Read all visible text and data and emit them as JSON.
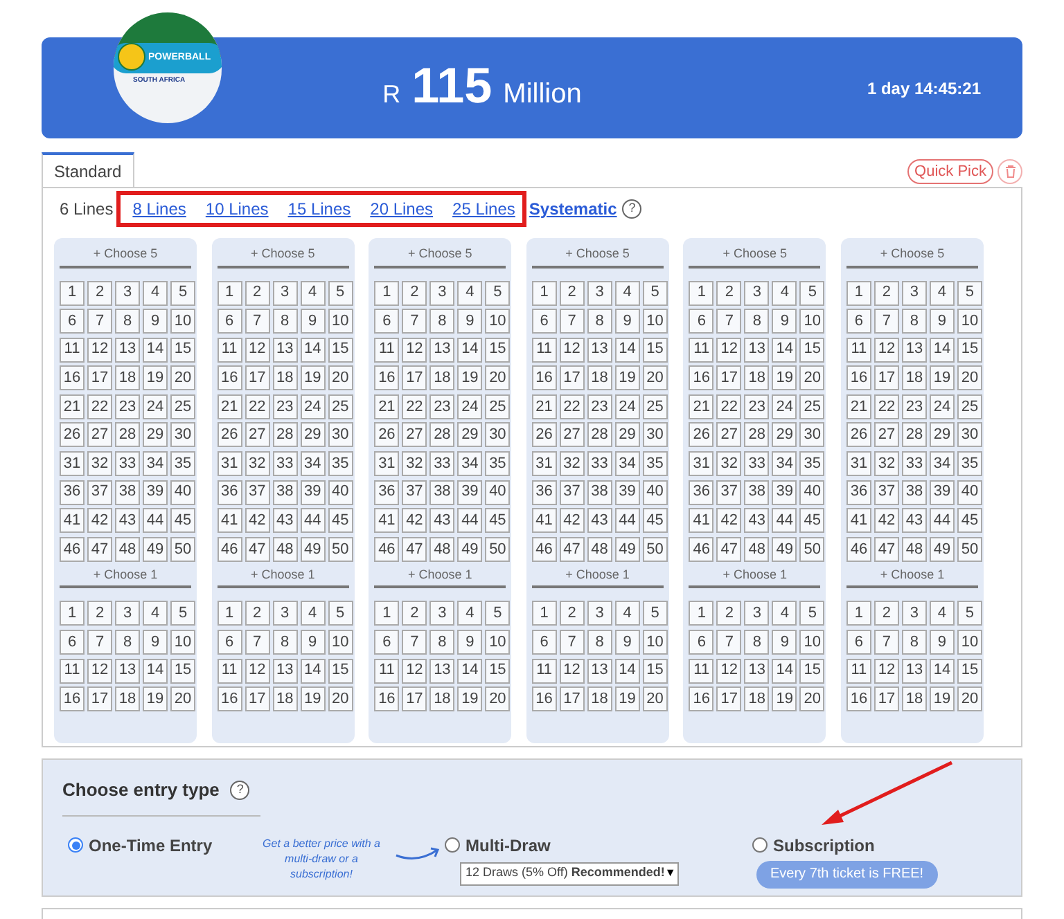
{
  "banner": {
    "logo_title": "POWERBALL",
    "logo_subtitle": "SOUTH AFRICA",
    "currency": "R",
    "amount": "115",
    "unit": "Million",
    "countdown": "1 day 14:45:21"
  },
  "tabs": [
    {
      "label": "Standard",
      "selected": true
    }
  ],
  "quick_pick": "Quick Pick",
  "line_options": [
    {
      "label": "6 Lines",
      "selected": true
    },
    {
      "label": "8 Lines",
      "selected": false
    },
    {
      "label": "10 Lines",
      "selected": false
    },
    {
      "label": "15 Lines",
      "selected": false
    },
    {
      "label": "20 Lines",
      "selected": false
    },
    {
      "label": "25 Lines",
      "selected": false
    }
  ],
  "systematic": {
    "label": "Systematic",
    "help": "?"
  },
  "tickets": [
    {
      "sections": [
        {
          "label": "+ Choose 5",
          "numbers": [
            "1",
            "2",
            "3",
            "4",
            "5",
            "6",
            "7",
            "8",
            "9",
            "10",
            "11",
            "12",
            "13",
            "14",
            "15",
            "16",
            "17",
            "18",
            "19",
            "20",
            "21",
            "22",
            "23",
            "24",
            "25",
            "26",
            "27",
            "28",
            "29",
            "30",
            "31",
            "32",
            "33",
            "34",
            "35",
            "36",
            "37",
            "38",
            "39",
            "40",
            "41",
            "42",
            "43",
            "44",
            "45",
            "46",
            "47",
            "48",
            "49",
            "50"
          ]
        },
        {
          "label": "+ Choose 1",
          "numbers": [
            "1",
            "2",
            "3",
            "4",
            "5",
            "6",
            "7",
            "8",
            "9",
            "10",
            "11",
            "12",
            "13",
            "14",
            "15",
            "16",
            "17",
            "18",
            "19",
            "20"
          ]
        }
      ]
    },
    {
      "sections": [
        {
          "label": "+ Choose 5",
          "numbers": [
            "1",
            "2",
            "3",
            "4",
            "5",
            "6",
            "7",
            "8",
            "9",
            "10",
            "11",
            "12",
            "13",
            "14",
            "15",
            "16",
            "17",
            "18",
            "19",
            "20",
            "21",
            "22",
            "23",
            "24",
            "25",
            "26",
            "27",
            "28",
            "29",
            "30",
            "31",
            "32",
            "33",
            "34",
            "35",
            "36",
            "37",
            "38",
            "39",
            "40",
            "41",
            "42",
            "43",
            "44",
            "45",
            "46",
            "47",
            "48",
            "49",
            "50"
          ]
        },
        {
          "label": "+ Choose 1",
          "numbers": [
            "1",
            "2",
            "3",
            "4",
            "5",
            "6",
            "7",
            "8",
            "9",
            "10",
            "11",
            "12",
            "13",
            "14",
            "15",
            "16",
            "17",
            "18",
            "19",
            "20"
          ]
        }
      ]
    },
    {
      "sections": [
        {
          "label": "+ Choose 5",
          "numbers": [
            "1",
            "2",
            "3",
            "4",
            "5",
            "6",
            "7",
            "8",
            "9",
            "10",
            "11",
            "12",
            "13",
            "14",
            "15",
            "16",
            "17",
            "18",
            "19",
            "20",
            "21",
            "22",
            "23",
            "24",
            "25",
            "26",
            "27",
            "28",
            "29",
            "30",
            "31",
            "32",
            "33",
            "34",
            "35",
            "36",
            "37",
            "38",
            "39",
            "40",
            "41",
            "42",
            "43",
            "44",
            "45",
            "46",
            "47",
            "48",
            "49",
            "50"
          ]
        },
        {
          "label": "+ Choose 1",
          "numbers": [
            "1",
            "2",
            "3",
            "4",
            "5",
            "6",
            "7",
            "8",
            "9",
            "10",
            "11",
            "12",
            "13",
            "14",
            "15",
            "16",
            "17",
            "18",
            "19",
            "20"
          ]
        }
      ]
    },
    {
      "sections": [
        {
          "label": "+ Choose 5",
          "numbers": [
            "1",
            "2",
            "3",
            "4",
            "5",
            "6",
            "7",
            "8",
            "9",
            "10",
            "11",
            "12",
            "13",
            "14",
            "15",
            "16",
            "17",
            "18",
            "19",
            "20",
            "21",
            "22",
            "23",
            "24",
            "25",
            "26",
            "27",
            "28",
            "29",
            "30",
            "31",
            "32",
            "33",
            "34",
            "35",
            "36",
            "37",
            "38",
            "39",
            "40",
            "41",
            "42",
            "43",
            "44",
            "45",
            "46",
            "47",
            "48",
            "49",
            "50"
          ]
        },
        {
          "label": "+ Choose 1",
          "numbers": [
            "1",
            "2",
            "3",
            "4",
            "5",
            "6",
            "7",
            "8",
            "9",
            "10",
            "11",
            "12",
            "13",
            "14",
            "15",
            "16",
            "17",
            "18",
            "19",
            "20"
          ]
        }
      ]
    },
    {
      "sections": [
        {
          "label": "+ Choose 5",
          "numbers": [
            "1",
            "2",
            "3",
            "4",
            "5",
            "6",
            "7",
            "8",
            "9",
            "10",
            "11",
            "12",
            "13",
            "14",
            "15",
            "16",
            "17",
            "18",
            "19",
            "20",
            "21",
            "22",
            "23",
            "24",
            "25",
            "26",
            "27",
            "28",
            "29",
            "30",
            "31",
            "32",
            "33",
            "34",
            "35",
            "36",
            "37",
            "38",
            "39",
            "40",
            "41",
            "42",
            "43",
            "44",
            "45",
            "46",
            "47",
            "48",
            "49",
            "50"
          ]
        },
        {
          "label": "+ Choose 1",
          "numbers": [
            "1",
            "2",
            "3",
            "4",
            "5",
            "6",
            "7",
            "8",
            "9",
            "10",
            "11",
            "12",
            "13",
            "14",
            "15",
            "16",
            "17",
            "18",
            "19",
            "20"
          ]
        }
      ]
    },
    {
      "sections": [
        {
          "label": "+ Choose 5",
          "numbers": [
            "1",
            "2",
            "3",
            "4",
            "5",
            "6",
            "7",
            "8",
            "9",
            "10",
            "11",
            "12",
            "13",
            "14",
            "15",
            "16",
            "17",
            "18",
            "19",
            "20",
            "21",
            "22",
            "23",
            "24",
            "25",
            "26",
            "27",
            "28",
            "29",
            "30",
            "31",
            "32",
            "33",
            "34",
            "35",
            "36",
            "37",
            "38",
            "39",
            "40",
            "41",
            "42",
            "43",
            "44",
            "45",
            "46",
            "47",
            "48",
            "49",
            "50"
          ]
        },
        {
          "label": "+ Choose 1",
          "numbers": [
            "1",
            "2",
            "3",
            "4",
            "5",
            "6",
            "7",
            "8",
            "9",
            "10",
            "11",
            "12",
            "13",
            "14",
            "15",
            "16",
            "17",
            "18",
            "19",
            "20"
          ]
        }
      ]
    }
  ],
  "entry_type": {
    "title": "Choose entry type",
    "help": "?",
    "options": [
      {
        "label": "One-Time Entry",
        "selected": true
      },
      {
        "label": "Multi-Draw",
        "selected": false
      },
      {
        "label": "Subscription",
        "selected": false
      }
    ],
    "promo_note": "Get a better price with a multi-draw or a subscription!",
    "draws_select": {
      "value": "12 Draws (5% Off) **Recommended!**",
      "caret": "▼"
    },
    "subscription_badge": "Every 7th ticket is FREE!"
  }
}
